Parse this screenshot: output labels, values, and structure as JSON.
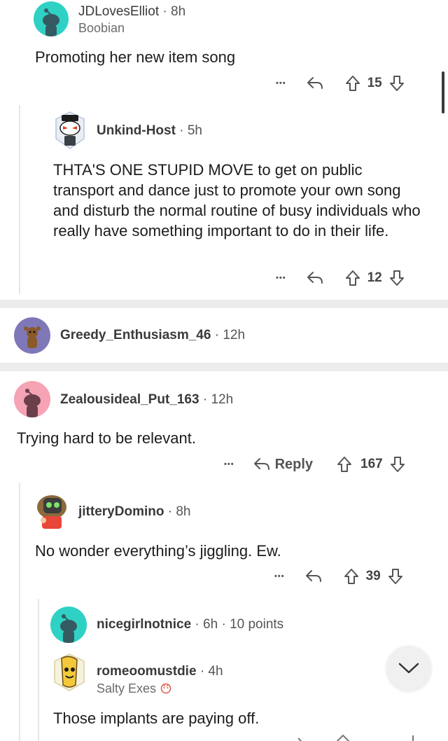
{
  "comments": [
    {
      "username": "JDLovesElliot",
      "time": "8h",
      "flair": "Boobian",
      "body": "Promoting her new item song",
      "votes": "15"
    },
    {
      "username": "Unkind-Host",
      "time": "5h",
      "body": "THTA'S ONE STUPID MOVE to get on public transport  and dance just to promote your own song and disturb the normal routine of busy individuals who really have something important to do in their life.",
      "votes": "12"
    },
    {
      "username": "Greedy_Enthusiasm_46",
      "time": "12h"
    },
    {
      "username": "Zealousideal_Put_163",
      "time": "12h",
      "body": "Trying hard to be relevant.",
      "reply_label": "Reply",
      "votes": "167"
    },
    {
      "username": "jitteryDomino",
      "time": "8h",
      "body": "No wonder everything’s jiggling. Ew.",
      "votes": "39"
    },
    {
      "username": "nicegirlnotnice",
      "time": "6h",
      "points": "10 points"
    },
    {
      "username": "romeoomustdie",
      "time": "4h",
      "flair": "Salty Exes",
      "body": "Those implants are paying off."
    }
  ],
  "separator": "·",
  "more_label": "•••",
  "colors": {
    "avatar_teal": "#2fd1c5",
    "avatar_pink": "#f5a3b5",
    "avatar_purple": "#7f78b8",
    "avatar_white": "#ffffff",
    "snoo_dark": "#355a61"
  },
  "icons": [
    "reply-icon",
    "upvote-icon",
    "downvote-icon",
    "more-icon",
    "chevron-down-icon",
    "snoo-avatar-icon"
  ]
}
